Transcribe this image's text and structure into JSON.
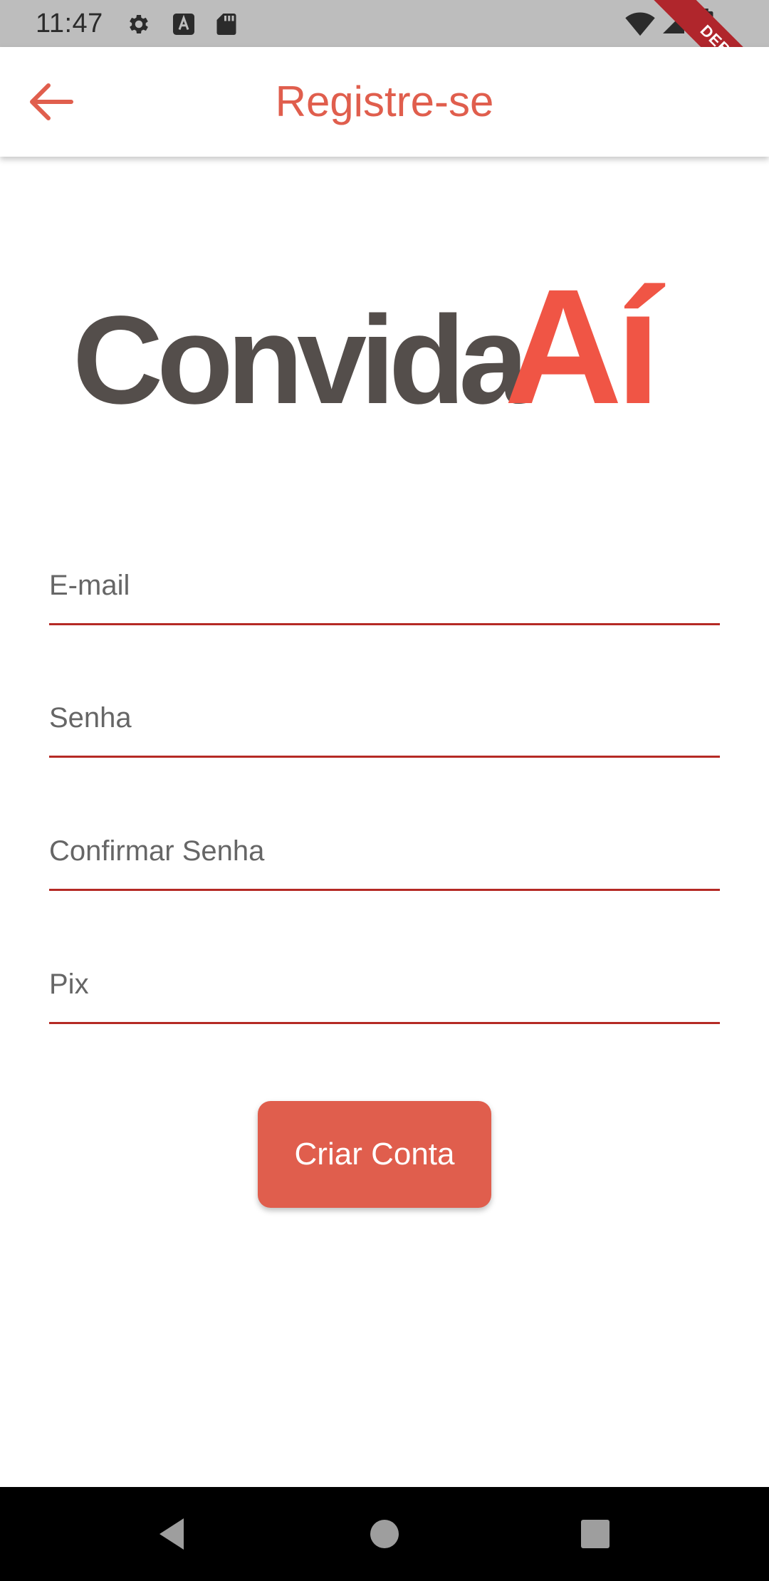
{
  "status_bar": {
    "time": "11:47",
    "icons": [
      "gear-icon",
      "keyboard-a-icon",
      "sd-card-icon",
      "wifi-icon",
      "signal-icon",
      "battery-icon"
    ],
    "debug_label": "DEBUG"
  },
  "app_bar": {
    "title": "Registre-se",
    "back_icon": "arrow-left-icon"
  },
  "logo": {
    "word_dark": "Convida",
    "word_accent": "Aí"
  },
  "form": {
    "fields": [
      {
        "label": "E-mail"
      },
      {
        "label": "Senha"
      },
      {
        "label": "Confirmar Senha"
      },
      {
        "label": "Pix"
      }
    ],
    "submit_label": "Criar Conta"
  },
  "nav_bar": {
    "icons": [
      "back-triangle-icon",
      "home-circle-icon",
      "recents-square-icon"
    ]
  },
  "colors": {
    "accent": "#e05e4d",
    "logo_dark": "#544e4b",
    "logo_accent": "#f05545",
    "underline": "#b52a25",
    "label_gray": "#666666",
    "status_bar_bg": "#bdbdbd",
    "debug_ribbon": "#b0262c"
  }
}
